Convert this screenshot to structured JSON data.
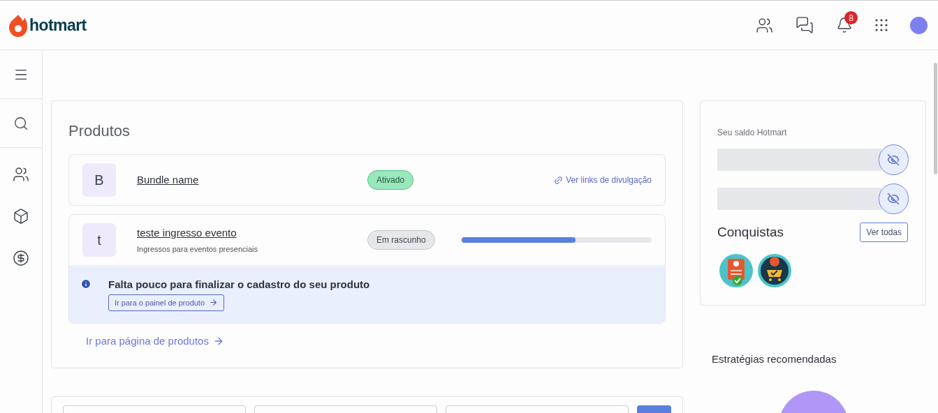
{
  "header": {
    "logo": "hotmart",
    "notifications": "8"
  },
  "products": {
    "title": "Produtos",
    "items": [
      {
        "initial": "B",
        "name": "Bundle name",
        "status": {
          "label": "Ativado",
          "kind": "active"
        },
        "link": "Ver links de divulgação"
      },
      {
        "initial": "t",
        "name": "teste ingresso evento",
        "subtitle": "Ingressos para eventos presenciais",
        "status": {
          "label": "Em rascunho",
          "kind": "draft"
        },
        "level": 0.6,
        "notice": {
          "text": "Falta pouco para finalizar o cadastro do seu produto",
          "button": "Ir para o painel de produto"
        }
      }
    ],
    "more_link": "Ir para página de produtos"
  },
  "balance": {
    "label": "Seu saldo Hotmart",
    "rows": [
      {
        "hidden": true
      },
      {
        "hidden": true
      }
    ]
  },
  "achievements": {
    "title": "Conquistas",
    "button": "Ver todas",
    "badges": [
      {
        "kind": "profile"
      },
      {
        "kind": "cart"
      }
    ]
  },
  "strategies": {
    "title": "Estratégias recomendadas"
  }
}
